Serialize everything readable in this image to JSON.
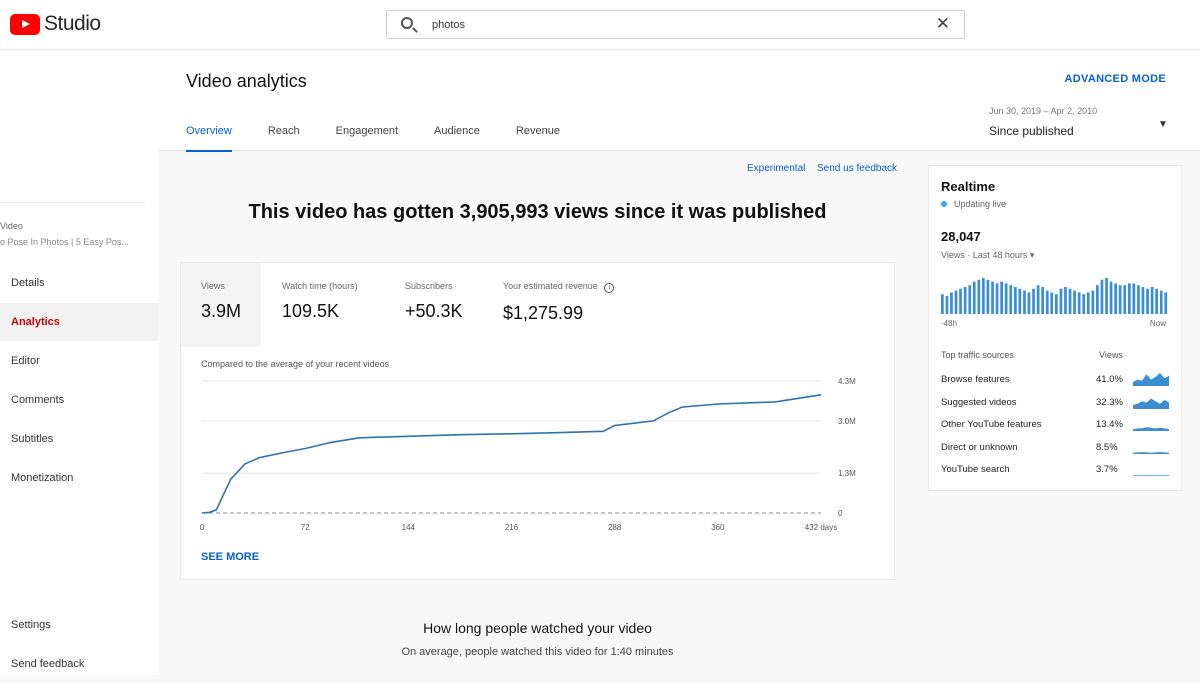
{
  "app": {
    "name": "Studio",
    "search_value": "photos"
  },
  "sidebar": {
    "video_label": "Video",
    "video_title": "o Pose In Photos | 5 Easy Pos...",
    "items": [
      {
        "label": "Details"
      },
      {
        "label": "Analytics"
      },
      {
        "label": "Editor"
      },
      {
        "label": "Comments"
      },
      {
        "label": "Subtitles"
      },
      {
        "label": "Monetization"
      }
    ],
    "footer": [
      {
        "label": "Settings"
      },
      {
        "label": "Send feedback"
      }
    ]
  },
  "header": {
    "title": "Video analytics",
    "advanced_mode": "ADVANCED MODE",
    "tabs": [
      {
        "label": "Overview"
      },
      {
        "label": "Reach"
      },
      {
        "label": "Engagement"
      },
      {
        "label": "Audience"
      },
      {
        "label": "Revenue"
      }
    ],
    "date_range": "Jun 30, 2019 – Apr 2, 2010",
    "date_label": "Since published"
  },
  "links": {
    "experimental": "Experimental",
    "feedback": "Send us feedback"
  },
  "headline": "This video has gotten 3,905,993 views since it was published",
  "metrics": [
    {
      "label": "Views",
      "value": "3.9M"
    },
    {
      "label": "Watch time (hours)",
      "value": "109.5K"
    },
    {
      "label": "Subscribers",
      "value": "+50.3K"
    },
    {
      "label": "Your estimated revenue",
      "value": "$1,275.99"
    }
  ],
  "compare_label": "Compared to the average of your recent videos",
  "see_more": "SEE MORE",
  "chart_data": {
    "type": "line",
    "x": [
      0,
      5,
      10,
      15,
      20,
      30,
      40,
      55,
      72,
      90,
      110,
      144,
      180,
      216,
      250,
      280,
      288,
      300,
      315,
      325,
      335,
      360,
      400,
      432
    ],
    "y": [
      0.0,
      0.02,
      0.1,
      0.6,
      1.1,
      1.6,
      1.8,
      1.95,
      2.1,
      2.3,
      2.45,
      2.5,
      2.55,
      2.58,
      2.62,
      2.66,
      2.85,
      2.92,
      3.0,
      3.25,
      3.45,
      3.55,
      3.62,
      3.85
    ],
    "x_ticks": [
      "0",
      "72",
      "144",
      "216",
      "288",
      "360",
      "432 days"
    ],
    "x_tick_values": [
      0,
      72,
      144,
      216,
      288,
      360,
      432
    ],
    "y_ticks": [
      "0",
      "1.3M",
      "3.0M",
      "4.3M"
    ],
    "y_tick_values": [
      0,
      1.3,
      3.0,
      4.3
    ],
    "xlim": [
      0,
      432
    ],
    "ylim": [
      0,
      4.3
    ],
    "baseline_dashed": true,
    "grid": true,
    "color": "#2c74b3"
  },
  "realtime": {
    "title": "Realtime",
    "live": "Updating live",
    "count": "28,047",
    "sub": "Views · Last 48 hours",
    "axis_start": "-48h",
    "axis_end": "Now",
    "bars": [
      0.55,
      0.5,
      0.6,
      0.65,
      0.7,
      0.75,
      0.8,
      0.9,
      0.95,
      1.0,
      0.95,
      0.9,
      0.85,
      0.9,
      0.85,
      0.8,
      0.75,
      0.7,
      0.65,
      0.6,
      0.7,
      0.8,
      0.75,
      0.65,
      0.6,
      0.55,
      0.7,
      0.75,
      0.7,
      0.65,
      0.6,
      0.55,
      0.6,
      0.65,
      0.8,
      0.95,
      1.0,
      0.9,
      0.85,
      0.8,
      0.8,
      0.85,
      0.85,
      0.8,
      0.75,
      0.7,
      0.75,
      0.7,
      0.65,
      0.6
    ],
    "bar_color": "#3b8fd1",
    "sources_header": "Top traffic sources",
    "views_header": "Views",
    "sources": [
      {
        "name": "Browse features",
        "pct": "41.0%",
        "spark": [
          0.3,
          0.5,
          0.4,
          0.9,
          0.5,
          0.7,
          1.0,
          0.6,
          0.8
        ]
      },
      {
        "name": "Suggested videos",
        "pct": "32.3%",
        "spark": [
          0.3,
          0.4,
          0.6,
          0.5,
          0.8,
          0.6,
          0.4,
          0.7,
          0.5
        ]
      },
      {
        "name": "Other YouTube features",
        "pct": "13.4%",
        "spark": [
          0.15,
          0.2,
          0.2,
          0.3,
          0.25,
          0.2,
          0.25,
          0.2,
          0.15
        ]
      },
      {
        "name": "Direct or unknown",
        "pct": "8.5%",
        "spark": [
          0.1,
          0.12,
          0.15,
          0.12,
          0.1,
          0.12,
          0.15,
          0.12,
          0.1
        ]
      },
      {
        "name": "YouTube search",
        "pct": "3.7%",
        "spark": [
          0.05,
          0.05,
          0.05,
          0.05,
          0.05,
          0.05,
          0.05,
          0.05,
          0.05
        ]
      }
    ]
  },
  "bottom": {
    "title": "How long people watched your video",
    "subtitle": "On average, people watched this video for 1:40 minutes"
  }
}
